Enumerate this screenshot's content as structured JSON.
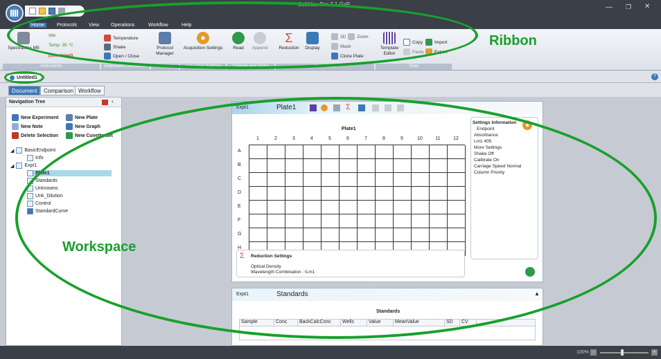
{
  "app": {
    "title": "SoftMax Pro 7.1 GxP"
  },
  "quick_access": [
    "new-icon",
    "open-folder-icon",
    "save-icon",
    "dropdown-icon"
  ],
  "menu": [
    "Home",
    "Protocols",
    "View",
    "Operations",
    "Workflow",
    "Help"
  ],
  "ribbon": {
    "instrument": {
      "name": "SpectraMax M5",
      "status": "Idle",
      "temp": "Temp: 35 °C",
      "mode": "(Simulated)",
      "group": "Instruments"
    },
    "commands": {
      "temperature": "Temperature",
      "shake": "Shake",
      "open_close": "Open / Close",
      "group": "Instrument Commands"
    },
    "protocols": {
      "manager": "Protocol Manager",
      "group": "Protocols"
    },
    "acquisition": {
      "settings": "Acquisition Settings",
      "group": "Acquisition Settings"
    },
    "controls": {
      "read": "Read",
      "append": "Append",
      "group": "Controls and Status"
    },
    "plate_tools": {
      "reduction": "Reduction",
      "display": "Display",
      "threed": "3D",
      "zoom": "Zoom",
      "mask": "Mask",
      "clone_plate": "Clone Plate",
      "group": "Plate Tools"
    },
    "tools": {
      "template_editor": "Template Editor",
      "copy": "Copy",
      "paste": "Paste",
      "import": "Import",
      "export": "Export",
      "group": "Tools"
    }
  },
  "doc_tab": {
    "name": "Untitled1"
  },
  "view_tabs": [
    "Document",
    "Comparison",
    "Workflow"
  ],
  "nav": {
    "title": "Navigation Tree",
    "actions": [
      "New Experiment",
      "New Plate",
      "New Note",
      "New Graph",
      "Delete Selection",
      "New Cuvette Set"
    ],
    "tree": [
      {
        "label": "BasicEndpoint",
        "indent": 0
      },
      {
        "label": "Info",
        "indent": 1
      },
      {
        "label": "Expt1",
        "indent": 0
      },
      {
        "label": "Plate1",
        "indent": 1,
        "selected": true
      },
      {
        "label": "Standards",
        "indent": 1
      },
      {
        "label": "Unknowns",
        "indent": 1
      },
      {
        "label": "Unk_Dilution",
        "indent": 1
      },
      {
        "label": "Control",
        "indent": 1
      },
      {
        "label": "StandardCurve",
        "indent": 1
      }
    ]
  },
  "plate": {
    "expt": "Expt1",
    "name": "Plate1",
    "grid_title": "Plate1",
    "columns": [
      "1",
      "2",
      "3",
      "4",
      "5",
      "6",
      "7",
      "8",
      "9",
      "10",
      "11",
      "12"
    ],
    "rows": [
      "A",
      "B",
      "C",
      "D",
      "E",
      "F",
      "G",
      "H"
    ],
    "settings_title": "Settings Information",
    "settings": [
      "Endpoint",
      "Absorbance",
      "Lm1  405",
      "More Settings",
      "Shake  Off",
      "Calibrate  On",
      "Carriage Speed  Normal",
      "Column Priority"
    ],
    "reduction_title": "Reduction Settings",
    "reduction_lines": [
      "Optical Density",
      "Wavelength Combination : !Lm1"
    ]
  },
  "standards": {
    "expt": "Expt1",
    "name": "Standards",
    "table_title": "Standards",
    "columns": [
      "Sample",
      "Conc",
      "BackCalcConc",
      "Wells",
      "Value",
      "MeanValue",
      "SD",
      "CV"
    ]
  },
  "status": {
    "zoom": "100%"
  },
  "annotations": {
    "ribbon": "Ribbon",
    "workspace": "Workspace"
  },
  "colors": {
    "accent": "#3c78b5",
    "annotation": "#18a02c",
    "titlebar": "#3b3f47"
  }
}
